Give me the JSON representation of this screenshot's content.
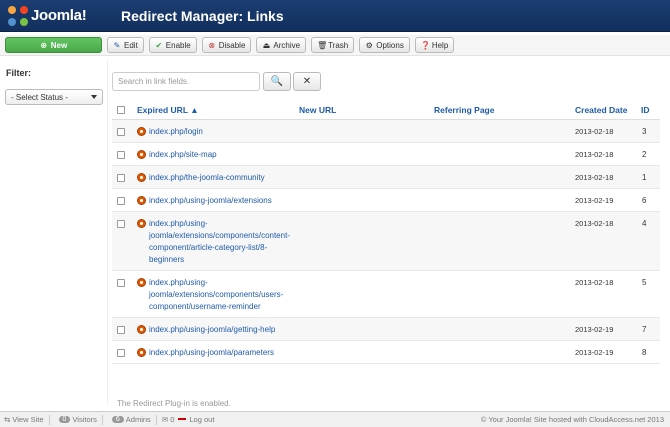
{
  "header": {
    "logo_text": "Joomla!",
    "title": "Redirect Manager: Links"
  },
  "toolbar": {
    "new": "New",
    "edit": "Edit",
    "enable": "Enable",
    "disable": "Disable",
    "archive": "Archive",
    "trash": "Trash",
    "options": "Options",
    "help": "Help"
  },
  "sidebar": {
    "filter_label": "Filter:",
    "status_select": "- Select Status -"
  },
  "search": {
    "placeholder": "Search in link fields."
  },
  "table": {
    "headers": {
      "expired": "Expired URL",
      "new": "New URL",
      "referring": "Referring Page",
      "created": "Created Date",
      "id": "ID"
    },
    "rows": [
      {
        "lines": [
          "index.php/login"
        ],
        "date": "2013-02-18",
        "id": "3"
      },
      {
        "lines": [
          "index.php/site-map"
        ],
        "date": "2013-02-18",
        "id": "2"
      },
      {
        "lines": [
          "index.php/the-joomla-community"
        ],
        "date": "2013-02-18",
        "id": "1"
      },
      {
        "lines": [
          "index.php/using-joomla/extensions"
        ],
        "date": "2013-02-19",
        "id": "6"
      },
      {
        "lines": [
          "index.php/using-",
          "joomla/extensions/components/content-",
          "component/article-category-list/8-",
          "beginners"
        ],
        "date": "2013-02-18",
        "id": "4"
      },
      {
        "lines": [
          "index.php/using-",
          "joomla/extensions/components/users-",
          "component/username-reminder"
        ],
        "date": "2013-02-18",
        "id": "5"
      },
      {
        "lines": [
          "index.php/using-joomla/getting-help"
        ],
        "date": "2013-02-19",
        "id": "7"
      },
      {
        "lines": [
          "index.php/using-joomla/parameters"
        ],
        "date": "2013-02-19",
        "id": "8"
      }
    ]
  },
  "notice": "The Redirect Plug-in is enabled.",
  "footer": {
    "view_site": "View Site",
    "visitors_count": "0",
    "visitors": "Visitors",
    "admins_count": "6",
    "admins": "Admins",
    "messages_count": "0",
    "logout": "Log out",
    "copyright": "© Your Joomla! Site hosted with CloudAccess.net 2013"
  }
}
